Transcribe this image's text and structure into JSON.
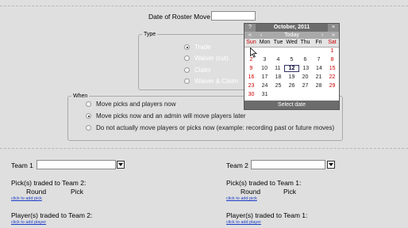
{
  "roster_move": {
    "date_label": "Date of Roster Move",
    "date_value": ""
  },
  "type_group": {
    "legend": "Type",
    "options": [
      {
        "label": "Trade",
        "selected": true
      },
      {
        "label": "Waiver (cut)",
        "selected": false
      },
      {
        "label": "Claim",
        "selected": false
      },
      {
        "label": "Waiver & Claim",
        "selected": false
      }
    ]
  },
  "when_group": {
    "legend": "When",
    "options": [
      {
        "label": "Move picks and players now",
        "selected": false
      },
      {
        "label": "Move picks now and an admin will move players later",
        "selected": true
      },
      {
        "label": "Do not actually move players or picks now (example: recording past or future moves)",
        "selected": false
      }
    ]
  },
  "calendar": {
    "help": "?",
    "month_title": "October, 2011",
    "close": "×",
    "nav": {
      "prev_year": "«",
      "prev_month": "‹",
      "today": "Today",
      "next_month": "›",
      "next_year": "»"
    },
    "day_headers": [
      "Sun",
      "Mon",
      "Tue",
      "Wed",
      "Thu",
      "Fri",
      "Sat"
    ],
    "weeks": [
      [
        "",
        "",
        "",
        "",
        "",
        "",
        "1"
      ],
      [
        "2",
        "3",
        "4",
        "5",
        "6",
        "7",
        "8"
      ],
      [
        "9",
        "10",
        "11",
        "12",
        "13",
        "14",
        "15"
      ],
      [
        "16",
        "17",
        "18",
        "19",
        "20",
        "21",
        "22"
      ],
      [
        "23",
        "24",
        "25",
        "26",
        "27",
        "28",
        "29"
      ],
      [
        "30",
        "31",
        "",
        "",
        "",
        "",
        ""
      ]
    ],
    "today_day": "12",
    "footer": "Select date"
  },
  "team1": {
    "label": "Team 1",
    "picks_heading": "Pick(s) traded to Team 2:",
    "round_header": "Round",
    "pick_header": "Pick",
    "add_pick_link": "click to add pick",
    "players_heading": "Player(s) traded to Team 2:",
    "add_player_link": "click to add player"
  },
  "team2": {
    "label": "Team 2",
    "picks_heading": "Pick(s) traded to Team 1:",
    "round_header": "Round",
    "pick_header": "Pick",
    "add_pick_link": "click to add pick",
    "players_heading": "Player(s) traded to Team 1:",
    "add_player_link": "click to add player"
  },
  "colors": {
    "background": "#dfdfdf",
    "weekend": "#cc0000",
    "link": "#1a3cc8",
    "calendar_header": "#6c6c6c"
  }
}
